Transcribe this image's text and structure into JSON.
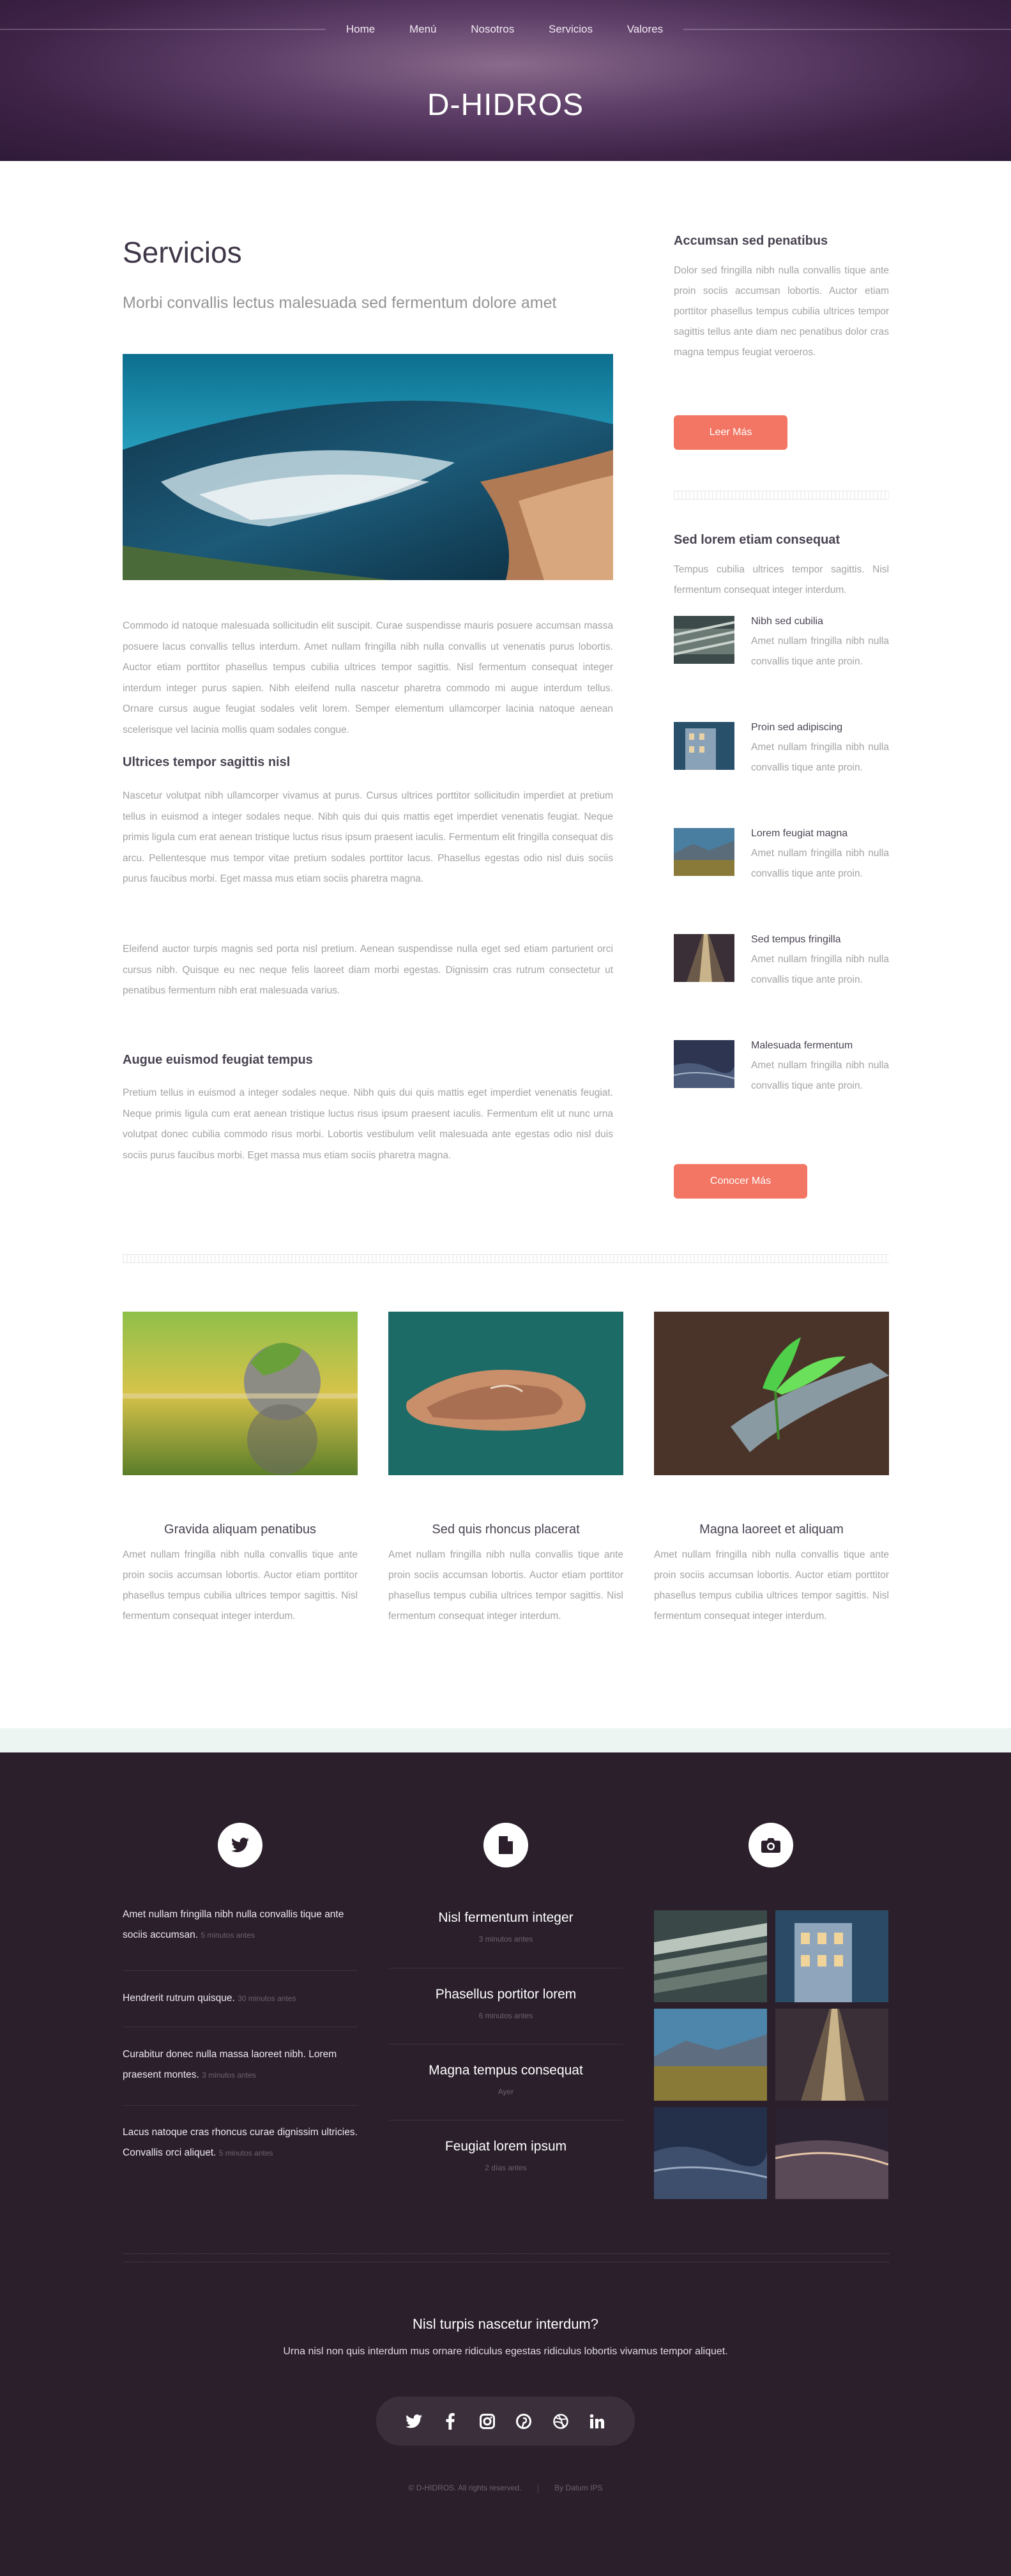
{
  "header": {
    "nav": [
      "Home",
      "Menú",
      "Nosotros",
      "Servicios",
      "Valores"
    ],
    "site_title": "D-HIDROS"
  },
  "main": {
    "title": "Servicios",
    "subtitle": "Morbi convallis lectus malesuada sed fermentum dolore amet",
    "intro": "Commodo id natoque malesuada sollicitudin elit suscipit. Curae suspendisse mauris posuere accumsan massa posuere lacus convallis tellus interdum. Amet nullam fringilla nibh nulla convallis ut venenatis purus lobortis. Auctor etiam porttitor phasellus tempus cubilia ultrices tempor sagittis. Nisl fermentum consequat integer interdum integer purus sapien. Nibh eleifend nulla nascetur pharetra commodo mi augue interdum tellus. Ornare cursus augue feugiat sodales velit lorem. Semper elementum ullamcorper lacinia natoque aenean scelerisque vel lacinia mollis quam sodales congue.",
    "section1_title": "Ultrices tempor sagittis nisl",
    "section1_p1": "Nascetur volutpat nibh ullamcorper vivamus at purus. Cursus ultrices porttitor sollicitudin imperdiet at pretium tellus in euismod a integer sodales neque. Nibh quis dui quis mattis eget imperdiet venenatis feugiat. Neque primis ligula cum erat aenean tristique luctus risus ipsum praesent iaculis. Fermentum elit fringilla consequat dis arcu. Pellentesque mus tempor vitae pretium sodales porttitor lacus. Phasellus egestas odio nisl duis sociis purus faucibus morbi. Eget massa mus etiam sociis pharetra magna.",
    "section1_p2": "Eleifend auctor turpis magnis sed porta nisl pretium. Aenean suspendisse nulla eget sed etiam parturient orci cursus nibh. Quisque eu nec neque felis laoreet diam morbi egestas. Dignissim cras rutrum consectetur ut penatibus fermentum nibh erat malesuada varius.",
    "section2_title": "Augue euismod feugiat tempus",
    "section2_p": "Pretium tellus in euismod a integer sodales neque. Nibh quis dui quis mattis eget imperdiet venenatis feugiat. Neque primis ligula cum erat aenean tristique luctus risus ipsum praesent iaculis. Fermentum elit ut nunc urna volutpat donec cubilia commodo risus morbi. Lobortis vestibulum velit malesuada ante egestas odio nisl duis sociis purus faucibus morbi. Eget massa mus etiam sociis pharetra magna."
  },
  "sidebar": {
    "box1_title": "Accumsan sed penatibus",
    "box1_text": "Dolor sed fringilla nibh nulla convallis tique ante proin sociis accumsan lobortis. Auctor etiam porttitor phasellus tempus cubilia ultrices tempor sagittis tellus ante diam nec penatibus dolor cras magna tempus feugiat veroeros.",
    "box1_button": "Leer Más",
    "box2_title": "Sed lorem etiam consequat",
    "box2_text": "Tempus cubilia ultrices tempor sagittis. Nisl fermentum consequat integer interdum.",
    "items": [
      {
        "title": "Nibh sed cubilia",
        "text": "Amet nullam fringilla nibh nulla convallis tique ante proin."
      },
      {
        "title": "Proin sed adipiscing",
        "text": "Amet nullam fringilla nibh nulla convallis tique ante proin."
      },
      {
        "title": "Lorem feugiat magna",
        "text": "Amet nullam fringilla nibh nulla convallis tique ante proin."
      },
      {
        "title": "Sed tempus fringilla",
        "text": "Amet nullam fringilla nibh nulla convallis tique ante proin."
      },
      {
        "title": "Malesuada fermentum",
        "text": "Amet nullam fringilla nibh nulla convallis tique ante proin."
      }
    ],
    "box2_button": "Conocer Más"
  },
  "features": [
    {
      "title": "Gravida aliquam penatibus",
      "text": "Amet nullam fringilla nibh nulla convallis tique ante proin sociis accumsan lobortis. Auctor etiam porttitor phasellus tempus cubilia ultrices tempor sagittis. Nisl fermentum consequat integer interdum."
    },
    {
      "title": "Sed quis rhoncus placerat",
      "text": "Amet nullam fringilla nibh nulla convallis tique ante proin sociis accumsan lobortis. Auctor etiam porttitor phasellus tempus cubilia ultrices tempor sagittis. Nisl fermentum consequat integer interdum."
    },
    {
      "title": "Magna laoreet et aliquam",
      "text": "Amet nullam fringilla nibh nulla convallis tique ante proin sociis accumsan lobortis. Auctor etiam porttitor phasellus tempus cubilia ultrices tempor sagittis. Nisl fermentum consequat integer interdum."
    }
  ],
  "footer": {
    "tweets": [
      {
        "text": "Amet nullam fringilla nibh nulla convallis tique ante sociis accumsan.",
        "time": "5 minutos antes"
      },
      {
        "text": "Hendrerit rutrum quisque.",
        "time": "30 minutos antes"
      },
      {
        "text": "Curabitur donec nulla massa laoreet nibh. Lorem praesent montes.",
        "time": "3 minutos antes"
      },
      {
        "text": "Lacus natoque cras rhoncus curae dignissim ultricies. Convallis orci aliquet.",
        "time": "5 minutos antes"
      }
    ],
    "posts": [
      {
        "title": "Nisl fermentum integer",
        "date": "3 minutos antes"
      },
      {
        "title": "Phasellus portitor lorem",
        "date": "6 minutos antes"
      },
      {
        "title": "Magna tempus consequat",
        "date": "Ayer"
      },
      {
        "title": "Feugiat lorem ipsum",
        "date": "2 días antes"
      }
    ],
    "closing_title": "Nisl turpis nascetur interdum?",
    "closing_text": "Urna nisl non quis interdum mus ornare ridiculus egestas ridiculus lobortis vivamus tempor aliquet.",
    "social": [
      "twitter",
      "facebook",
      "instagram",
      "pinterest",
      "dribbble",
      "linkedin"
    ],
    "copyright": "© D-HIDROS. All rights reserved.",
    "credit": "By Datum IPS"
  },
  "colors": {
    "header_purple": "#4a2d55",
    "accent_button": "#f37563",
    "footer_bg": "#2a1f2b",
    "band": "#edf5f2"
  }
}
